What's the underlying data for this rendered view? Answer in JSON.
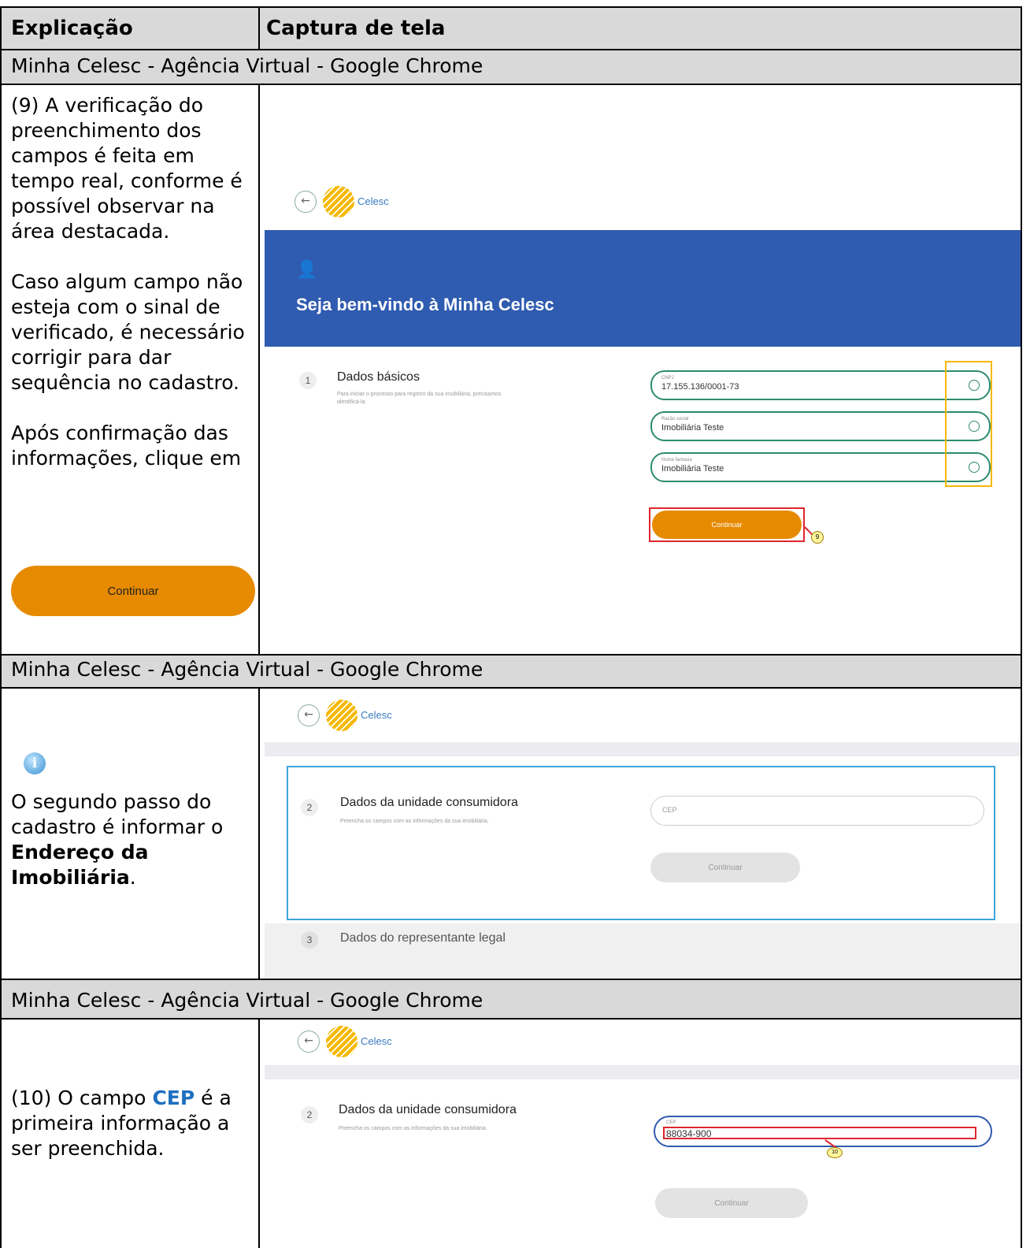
{
  "table": {
    "col1_header": "Explicação",
    "col2_header": "Captura de tela",
    "window_title": "Minha Celesc - Agência Virtual - Google Chrome"
  },
  "row1": {
    "p1": "(9) A verificação do preenchimento dos campos é feita em tempo real, conforme é possível observar na área destacada.",
    "p2": "Caso algum campo não esteja com o sinal de verificado, é necessário corrigir para dar sequência no cadastro.",
    "p3": "Após confirmação das informações, clique em",
    "button_label": "Continuar",
    "screen": {
      "logo": "Celesc",
      "banner_title": "Seja bem-vindo à Minha Celesc",
      "step_number": "1",
      "step_title": "Dados básicos",
      "step_desc": "Para iniciar o processo para registro da sua imobiliária, precisamos identificá-la.",
      "fields": [
        {
          "label": "CNPJ",
          "value": "17.155.136/0001-73"
        },
        {
          "label": "Razão social",
          "value": "Imobiliária Teste"
        },
        {
          "label": "Nome fantasia",
          "value": "Imobiliária Teste"
        }
      ],
      "continue_label": "Continuar",
      "callout": "9"
    }
  },
  "row2": {
    "p1": "O segundo passo do cadastro é informar o",
    "bold": "Endereço da Imobiliária",
    "p_end": ".",
    "screen": {
      "logo": "Celesc",
      "step_number": "2",
      "step_title": "Dados da unidade consumidora",
      "step_desc": "Preencha os campos com as informações da sua imobiliária.",
      "cep_placeholder": "CEP",
      "continue_label": "Continuar",
      "step3_number": "3",
      "step3_title": "Dados do representante legal"
    }
  },
  "row3": {
    "p_pre": "(10) O campo",
    "highlight": "CEP",
    "p_post": "é a primeira informação a ser preenchida.",
    "screen": {
      "logo": "Celesc",
      "step_number": "2",
      "step_title": "Dados da unidade consumidora",
      "step_desc": "Preencha os campos com as informações da sua imobiliária.",
      "cep_label": "CEP",
      "cep_value": "88034-900",
      "continue_label": "Continuar",
      "callout": "10"
    }
  },
  "colors": {
    "header_gray": "#d9d9d9",
    "orange": "#e68a00",
    "banner_blue": "#2f5bb0",
    "highlight_blue": "#1e6fc0",
    "check_green": "#2d8b6e"
  }
}
